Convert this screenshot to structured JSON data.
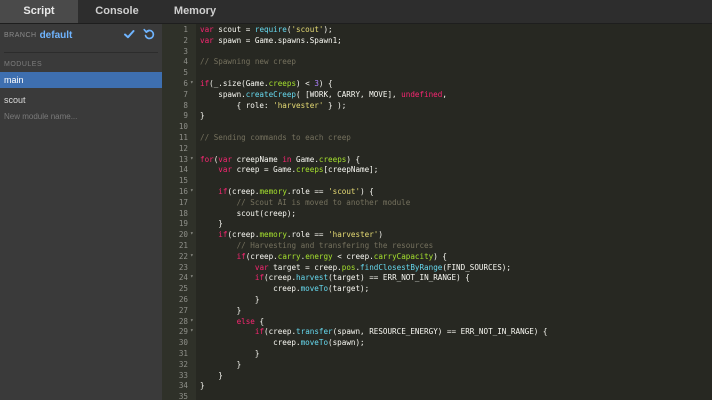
{
  "tabs": [
    "Script",
    "Console",
    "Memory"
  ],
  "sidebar": {
    "branch_label": "BRANCH",
    "branch_name": "default",
    "modules_label": "MODULES",
    "modules": [
      "main",
      "scout"
    ],
    "new_module_placeholder": "New module name..."
  },
  "colors": {
    "accent": "#3e6fb0",
    "branch": "#6fb4ff",
    "editor_bg": "#272822",
    "sidebar_bg": "#3a3a3a"
  },
  "code": [
    [
      [
        "kw",
        "var"
      ],
      [
        "plain",
        " scout = "
      ],
      [
        "fn",
        "require"
      ],
      [
        "plain",
        "("
      ],
      [
        "str",
        "'scout'"
      ],
      [
        "plain",
        ");"
      ]
    ],
    [
      [
        "kw",
        "var"
      ],
      [
        "plain",
        " spawn = Game.spawns.Spawn1;"
      ]
    ],
    [],
    [
      [
        "cmt",
        "// Spawning new creep"
      ]
    ],
    [],
    [
      [
        "kw",
        "if"
      ],
      [
        "plain",
        "(_.size(Game."
      ],
      [
        "prop",
        "creeps"
      ],
      [
        "plain",
        ") < "
      ],
      [
        "num",
        "3"
      ],
      [
        "plain",
        ") {"
      ]
    ],
    [
      [
        "plain",
        "    spawn."
      ],
      [
        "fn",
        "createCreep"
      ],
      [
        "plain",
        "( [WORK, CARRY, MOVE], "
      ],
      [
        "kw",
        "undefined"
      ],
      [
        "plain",
        ","
      ]
    ],
    [
      [
        "plain",
        "        { role: "
      ],
      [
        "str",
        "'harvester'"
      ],
      [
        "plain",
        " } );"
      ]
    ],
    [
      [
        "plain",
        "}"
      ]
    ],
    [],
    [
      [
        "cmt",
        "// Sending commands to each creep"
      ]
    ],
    [],
    [
      [
        "kw",
        "for"
      ],
      [
        "plain",
        "("
      ],
      [
        "kw",
        "var"
      ],
      [
        "plain",
        " creepName "
      ],
      [
        "kw",
        "in"
      ],
      [
        "plain",
        " Game."
      ],
      [
        "prop",
        "creeps"
      ],
      [
        "plain",
        ") {"
      ]
    ],
    [
      [
        "plain",
        "    "
      ],
      [
        "kw",
        "var"
      ],
      [
        "plain",
        " creep = Game."
      ],
      [
        "prop",
        "creeps"
      ],
      [
        "plain",
        "[creepName];"
      ]
    ],
    [],
    [
      [
        "plain",
        "    "
      ],
      [
        "kw",
        "if"
      ],
      [
        "plain",
        "(creep."
      ],
      [
        "prop",
        "memory"
      ],
      [
        "plain",
        ".role == "
      ],
      [
        "str",
        "'scout'"
      ],
      [
        "plain",
        ") {"
      ]
    ],
    [
      [
        "plain",
        "        "
      ],
      [
        "cmt",
        "// Scout AI is moved to another module"
      ]
    ],
    [
      [
        "plain",
        "        scout(creep);"
      ]
    ],
    [
      [
        "plain",
        "    }"
      ]
    ],
    [
      [
        "plain",
        "    "
      ],
      [
        "kw",
        "if"
      ],
      [
        "plain",
        "(creep."
      ],
      [
        "prop",
        "memory"
      ],
      [
        "plain",
        ".role == "
      ],
      [
        "str",
        "'harvester'"
      ],
      [
        "plain",
        ")"
      ]
    ],
    [
      [
        "plain",
        "        "
      ],
      [
        "cmt",
        "// Harvesting and transfering the resources"
      ]
    ],
    [
      [
        "plain",
        "        "
      ],
      [
        "kw",
        "if"
      ],
      [
        "plain",
        "(creep."
      ],
      [
        "prop",
        "carry"
      ],
      [
        "plain",
        "."
      ],
      [
        "prop",
        "energy"
      ],
      [
        "plain",
        " < creep."
      ],
      [
        "prop",
        "carryCapacity"
      ],
      [
        "plain",
        ") {"
      ]
    ],
    [
      [
        "plain",
        "            "
      ],
      [
        "kw",
        "var"
      ],
      [
        "plain",
        " target = creep."
      ],
      [
        "prop",
        "pos"
      ],
      [
        "plain",
        "."
      ],
      [
        "fn",
        "findClosestByRange"
      ],
      [
        "plain",
        "(FIND_SOURCES);"
      ]
    ],
    [
      [
        "plain",
        "            "
      ],
      [
        "kw",
        "if"
      ],
      [
        "plain",
        "(creep."
      ],
      [
        "fn",
        "harvest"
      ],
      [
        "plain",
        "(target) == ERR_NOT_IN_RANGE) {"
      ]
    ],
    [
      [
        "plain",
        "                creep."
      ],
      [
        "fn",
        "moveTo"
      ],
      [
        "plain",
        "(target);"
      ]
    ],
    [
      [
        "plain",
        "            }"
      ]
    ],
    [
      [
        "plain",
        "        }"
      ]
    ],
    [
      [
        "plain",
        "        "
      ],
      [
        "kw",
        "else"
      ],
      [
        "plain",
        " {"
      ]
    ],
    [
      [
        "plain",
        "            "
      ],
      [
        "kw",
        "if"
      ],
      [
        "plain",
        "(creep."
      ],
      [
        "fn",
        "transfer"
      ],
      [
        "plain",
        "(spawn, RESOURCE_ENERGY) == ERR_NOT_IN_RANGE) {"
      ]
    ],
    [
      [
        "plain",
        "                creep."
      ],
      [
        "fn",
        "moveTo"
      ],
      [
        "plain",
        "(spawn);"
      ]
    ],
    [
      [
        "plain",
        "            }"
      ]
    ],
    [
      [
        "plain",
        "        }"
      ]
    ],
    [
      [
        "plain",
        "    }"
      ]
    ],
    [
      [
        "plain",
        "}"
      ]
    ],
    []
  ],
  "fold_lines": [
    6,
    13,
    16,
    20,
    22,
    24,
    28,
    29
  ]
}
